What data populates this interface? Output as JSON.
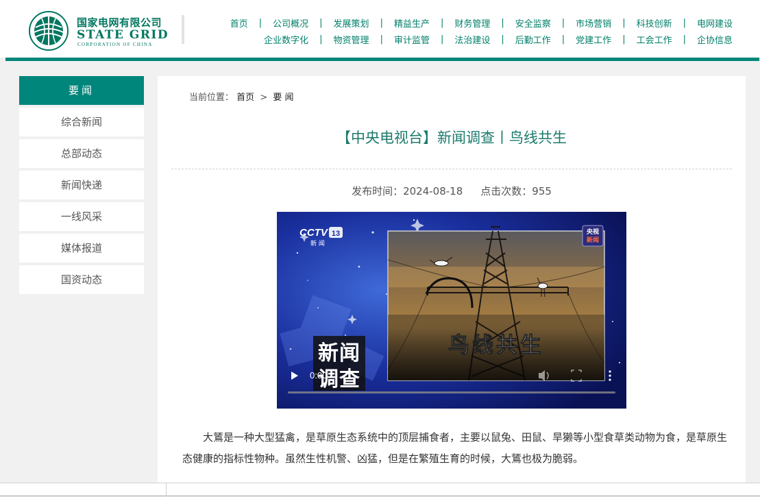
{
  "header": {
    "logo_cn": "国家电网有限公司",
    "logo_en": "STATE GRID",
    "logo_sub": "CORPORATION OF CHINA",
    "nav_row1": [
      "首页",
      "公司概况",
      "发展策划",
      "精益生产",
      "财务管理",
      "安全监察",
      "市场营销",
      "科技创新",
      "电网建设"
    ],
    "nav_row2": [
      "企业数字化",
      "物资管理",
      "审计监管",
      "法治建设",
      "后勤工作",
      "党建工作",
      "工会工作",
      "企协信息"
    ],
    "separator": "|"
  },
  "sidebar": {
    "title": "要闻",
    "items": [
      "综合新闻",
      "总部动态",
      "新闻快递",
      "一线风采",
      "媒体报道",
      "国资动态"
    ]
  },
  "breadcrumb": {
    "label": "当前位置：",
    "home": "首页",
    "arrow": ">",
    "current": "要 闻"
  },
  "article": {
    "title": "【中央电视台】新闻调查丨鸟线共生",
    "publish_label": "发布时间：",
    "publish_date": "2024-08-18",
    "views_label": "点击次数：",
    "views": "955",
    "paragraph1": "大鵟是一种大型猛禽，是草原生态系统中的顶层捕食者，主要以鼠兔、田鼠、旱獭等小型食草类动物为食，是草原生态健康的指标性物种。虽然生性机警、凶猛，但是在繁殖生育的时候，大鵟也极为脆弱。"
  },
  "video": {
    "channel_logo": "CCTV",
    "channel_num": "13",
    "channel_sub": "新 闻",
    "corner_badge_top": "央视",
    "corner_badge_bottom": "新闻",
    "show_title_a": "新闻",
    "show_title_b": "调查",
    "overlay_text": "鸟线共生",
    "time": "0:00",
    "progress": 0
  },
  "colors": {
    "brand": "#00867a",
    "title": "#1b7a6c",
    "nav": "#00806a"
  }
}
